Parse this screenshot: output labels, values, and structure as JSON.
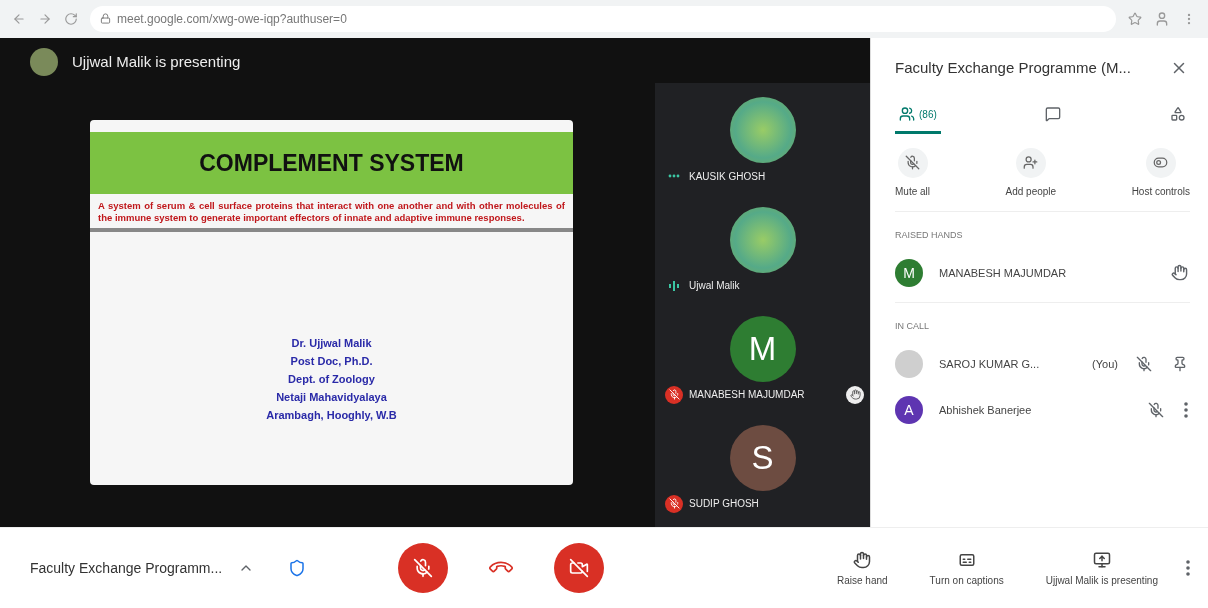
{
  "browser": {
    "url": "meet.google.com/xwg-owe-iqp?authuser=0"
  },
  "presenter_banner": {
    "text": "Ujjwal Malik is presenting"
  },
  "slide": {
    "title": "COMPLEMENT SYSTEM",
    "description": "A system of serum & cell surface proteins that interact with one another and with other molecules of the immune system to generate important effectors of innate and adaptive immune responses.",
    "credits": [
      "Dr. Ujjwal Malik",
      "Post Doc, Ph.D.",
      "Dept. of Zoology",
      "Netaji Mahavidyalaya",
      "Arambagh, Hooghly, W.B"
    ]
  },
  "tiles": [
    {
      "name": "KAUSIK GHOSH",
      "muted": false,
      "speaking": false,
      "hand_raised": false
    },
    {
      "name": "Ujwal Malik",
      "muted": false,
      "speaking": true,
      "hand_raised": false
    },
    {
      "name": "MANABESH MAJUMDAR",
      "muted": true,
      "letter": "M",
      "color": "#2e7d32",
      "hand_raised": true
    },
    {
      "name": "SUDIP GHOSH",
      "muted": true,
      "letter": "S",
      "color": "#6d4c41",
      "hand_raised": false
    }
  ],
  "panel": {
    "title": "Faculty Exchange Programme (M...",
    "tabs": [
      {
        "kind": "people",
        "label": "(86)",
        "selected": true
      },
      {
        "kind": "chat",
        "selected": false
      },
      {
        "kind": "activities",
        "selected": false
      }
    ],
    "actions": [
      {
        "kind": "mute",
        "label": "Mute all"
      },
      {
        "kind": "add",
        "label": "Add people"
      },
      {
        "kind": "host",
        "label": "Host controls"
      }
    ],
    "raised_hands_heading": "RAISED HANDS",
    "raised_hands": [
      {
        "name": "MANABESH MAJUMDAR",
        "letter": "M",
        "color": "#2e7d32"
      }
    ],
    "in_call_heading": "IN CALL",
    "participants": [
      {
        "kind": "self",
        "name": "SAROJ KUMAR G...",
        "suffix": "(You)"
      },
      {
        "kind": "member",
        "name": "Abhishek Banerjee",
        "letter": "A",
        "color": "#5e35b1"
      }
    ]
  },
  "bottom": {
    "meeting_title": "Faculty Exchange Programm...",
    "mic_on": false,
    "camera_on": false,
    "raise_hand": "Raise hand",
    "captions": "Turn on captions",
    "presenting": "Ujjwal Malik is presenting"
  }
}
